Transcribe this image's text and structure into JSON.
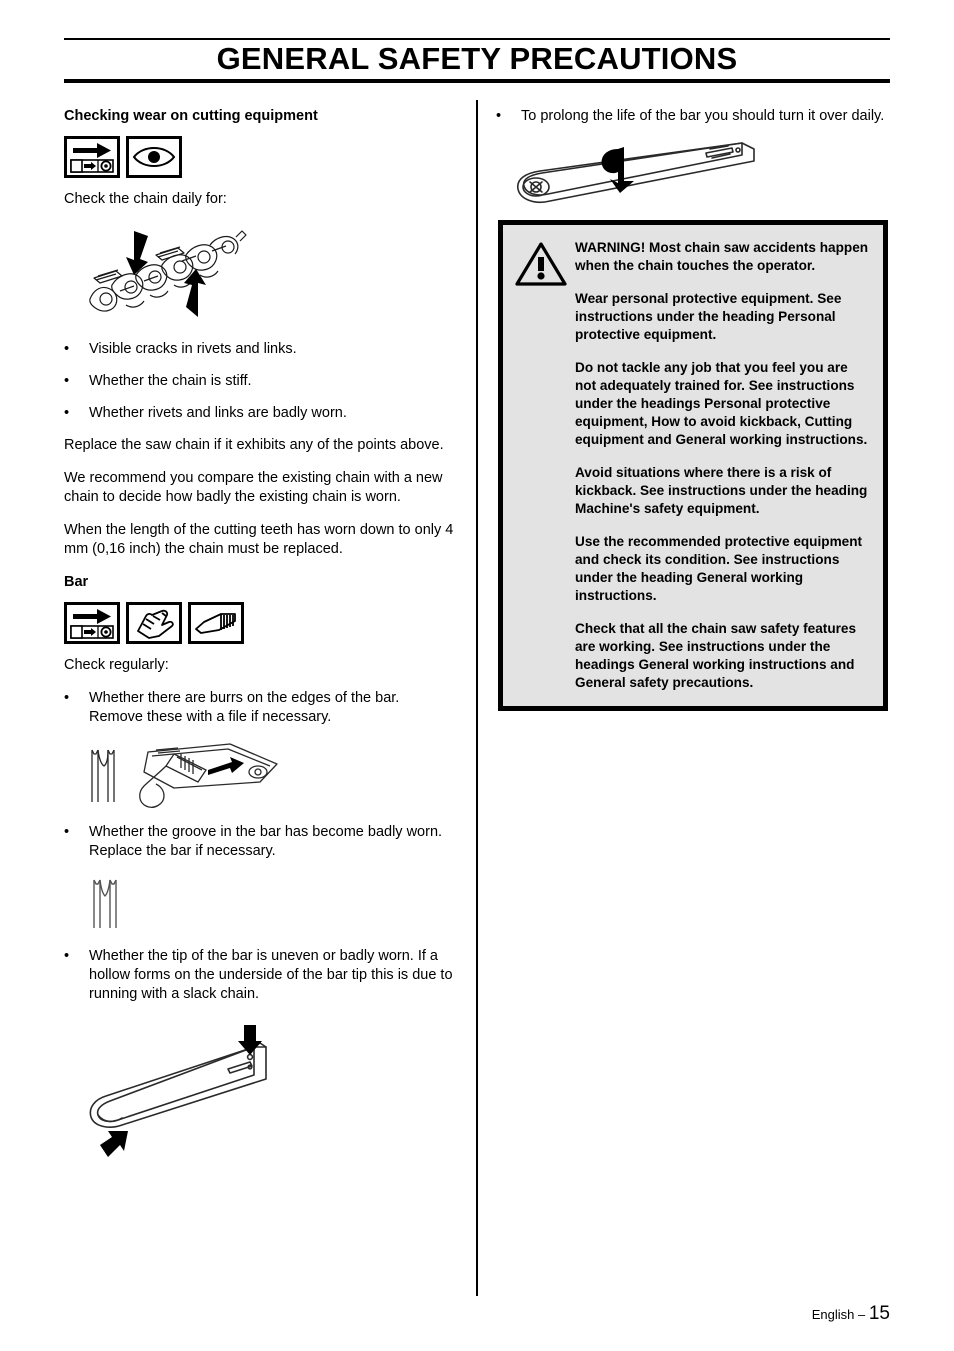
{
  "header": {
    "title": "GENERAL SAFETY PRECAUTIONS"
  },
  "left_column": {
    "section1": {
      "heading": "Checking wear on cutting equipment",
      "icons": [
        {
          "name": "bar-arrow-icon",
          "label": "bar-direction-arrow"
        },
        {
          "name": "eye-icon",
          "label": "visual-inspection-eye"
        }
      ],
      "intro": "Check the chain daily for:",
      "chain_illustration": "saw-chain-with-arrows",
      "bullets": [
        "Visible cracks in rivets and links.",
        "Whether the chain is stiff.",
        "Whether rivets and links are badly worn."
      ],
      "paragraphs": [
        "Replace the saw chain if it exhibits any of the points above.",
        "We recommend you compare the existing chain with a new chain to decide how badly the existing chain is worn.",
        "When the length of the cutting teeth has worn down to only 4 mm (0,16 inch) the chain must be replaced."
      ]
    },
    "section2": {
      "heading": "Bar",
      "icons": [
        {
          "name": "bar-arrow-icon",
          "label": "bar-direction-arrow"
        },
        {
          "name": "glove-icon",
          "label": "protective-glove"
        },
        {
          "name": "file-icon",
          "label": "flat-file-tool"
        }
      ],
      "intro": "Check regularly:",
      "bullets": [
        "Whether there are burrs on the edges of the bar. Remove these with a file if necessary.",
        "Whether the groove in the bar has become badly worn. Replace the bar if necessary.",
        "Whether the tip of the bar is uneven or badly worn. If a hollow forms on the underside of the bar tip this is due to running with a slack chain."
      ],
      "illustrations": [
        "bar-groove-cross-section-and-file-on-bar",
        "bar-groove-cross-section-worn",
        "guide-bar-tip-wear-arrows"
      ]
    }
  },
  "right_column": {
    "bullet": "To prolong the life of the bar you should turn it over daily.",
    "bar_flip_illustration": "guide-bar-turn-over-arrow",
    "warning": {
      "icon": "warning-triangle-icon",
      "paragraphs": [
        "WARNING! Most chain saw accidents happen when the chain touches the operator.",
        "Wear personal protective equipment. See instructions under the heading Personal protective equipment.",
        "Do not tackle any job that you feel you are not adequately trained for. See instructions under the headings Personal protective equipment, How to avoid kickback, Cutting equipment and General working instructions.",
        "Avoid situations where there is a risk of kickback. See instructions under the heading Machine's safety equipment.",
        "Use the recommended protective equipment and check its condition. See instructions under the heading General working instructions.",
        "Check that all the chain saw safety features are working. See instructions under the headings General working instructions and General safety precautions."
      ],
      "background_color": "#e3e3e3",
      "border_color": "#000000"
    }
  },
  "footer": {
    "language": "English",
    "separator": "–",
    "page_number": "15"
  },
  "bullet_char": "•"
}
